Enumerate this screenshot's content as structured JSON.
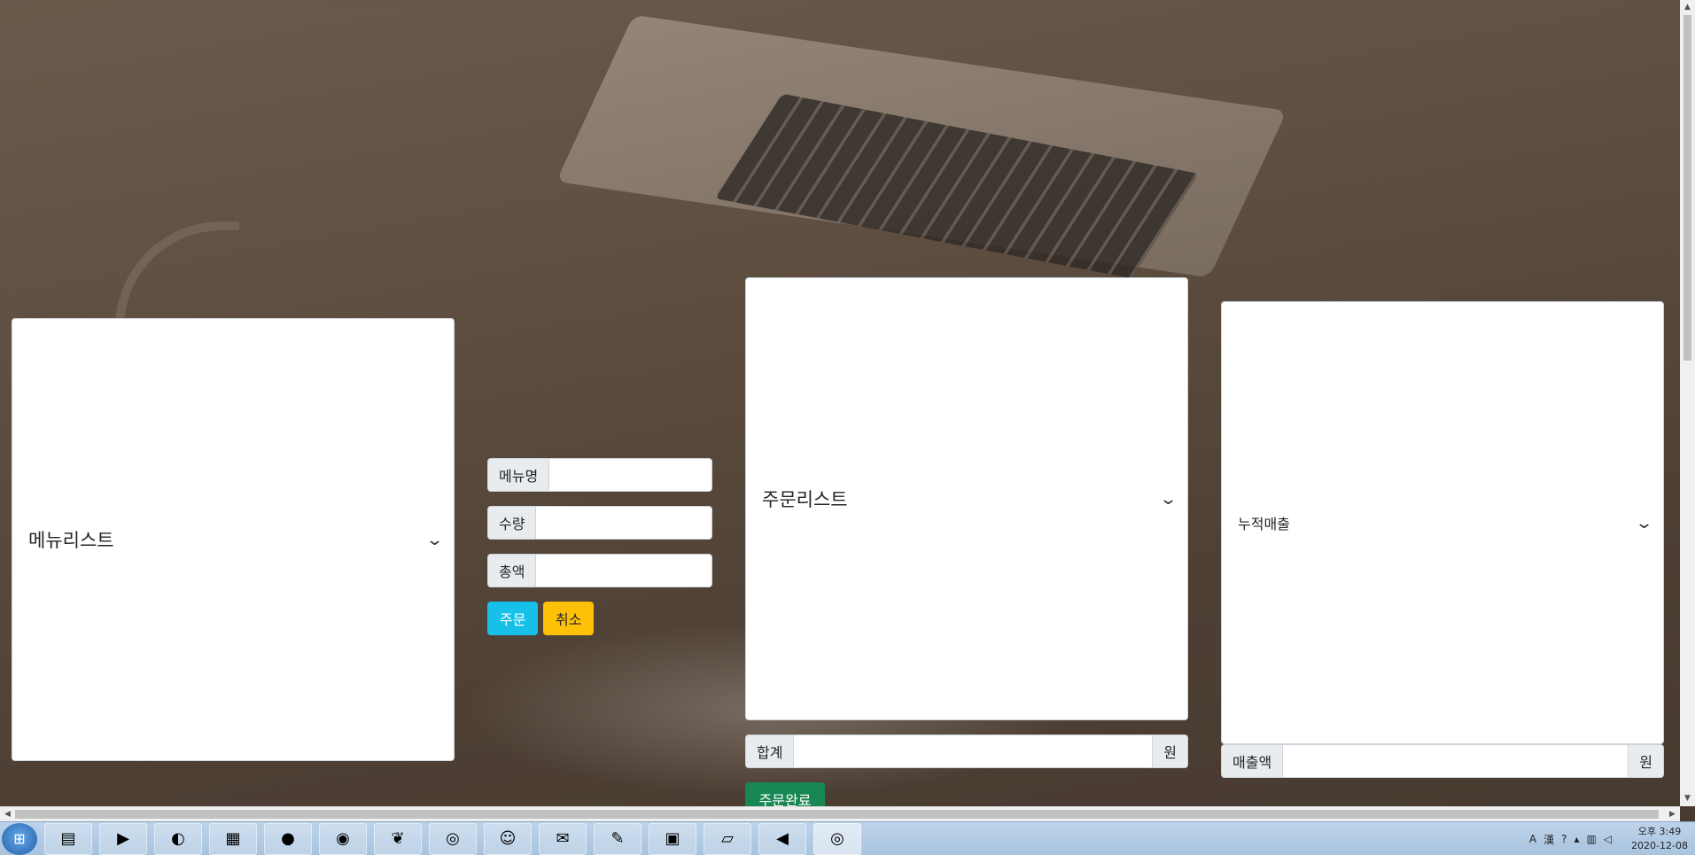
{
  "panels": {
    "menu_list": {
      "label": "메뉴리스트"
    },
    "order_list": {
      "label": "주문리스트"
    },
    "sales_list": {
      "label": "누적매출"
    }
  },
  "order_form": {
    "menu_name_label": "메뉴명",
    "menu_name_value": "",
    "quantity_label": "수량",
    "quantity_value": "",
    "total_label": "총액",
    "total_value": "",
    "order_button": "주문",
    "cancel_button": "취소"
  },
  "order_summary": {
    "sum_label": "합계",
    "sum_value": "",
    "sum_unit": "원",
    "complete_button": "주문완료"
  },
  "sales_summary": {
    "sales_label": "매출액",
    "sales_value": "",
    "sales_unit": "원"
  },
  "colors": {
    "order_button": "#17c0e8",
    "cancel_button": "#ffc107",
    "complete_button": "#198754"
  },
  "taskbar": {
    "items": [
      "file-explorer-icon",
      "media-player-icon",
      "edge-icon",
      "task-scheduler-icon",
      "firefox-icon",
      "eclipse-icon",
      "spring-icon",
      "chrome-icon",
      "messenger-icon",
      "kakaotalk-icon",
      "paint-icon",
      "zoom-icon",
      "sticky-notes-icon",
      "vscode-icon",
      "chrome-active-icon"
    ],
    "tray": {
      "ime_label": "A",
      "hanja_label": "漢",
      "clock_time": "오후 3:49",
      "clock_date": "2020-12-08"
    }
  }
}
